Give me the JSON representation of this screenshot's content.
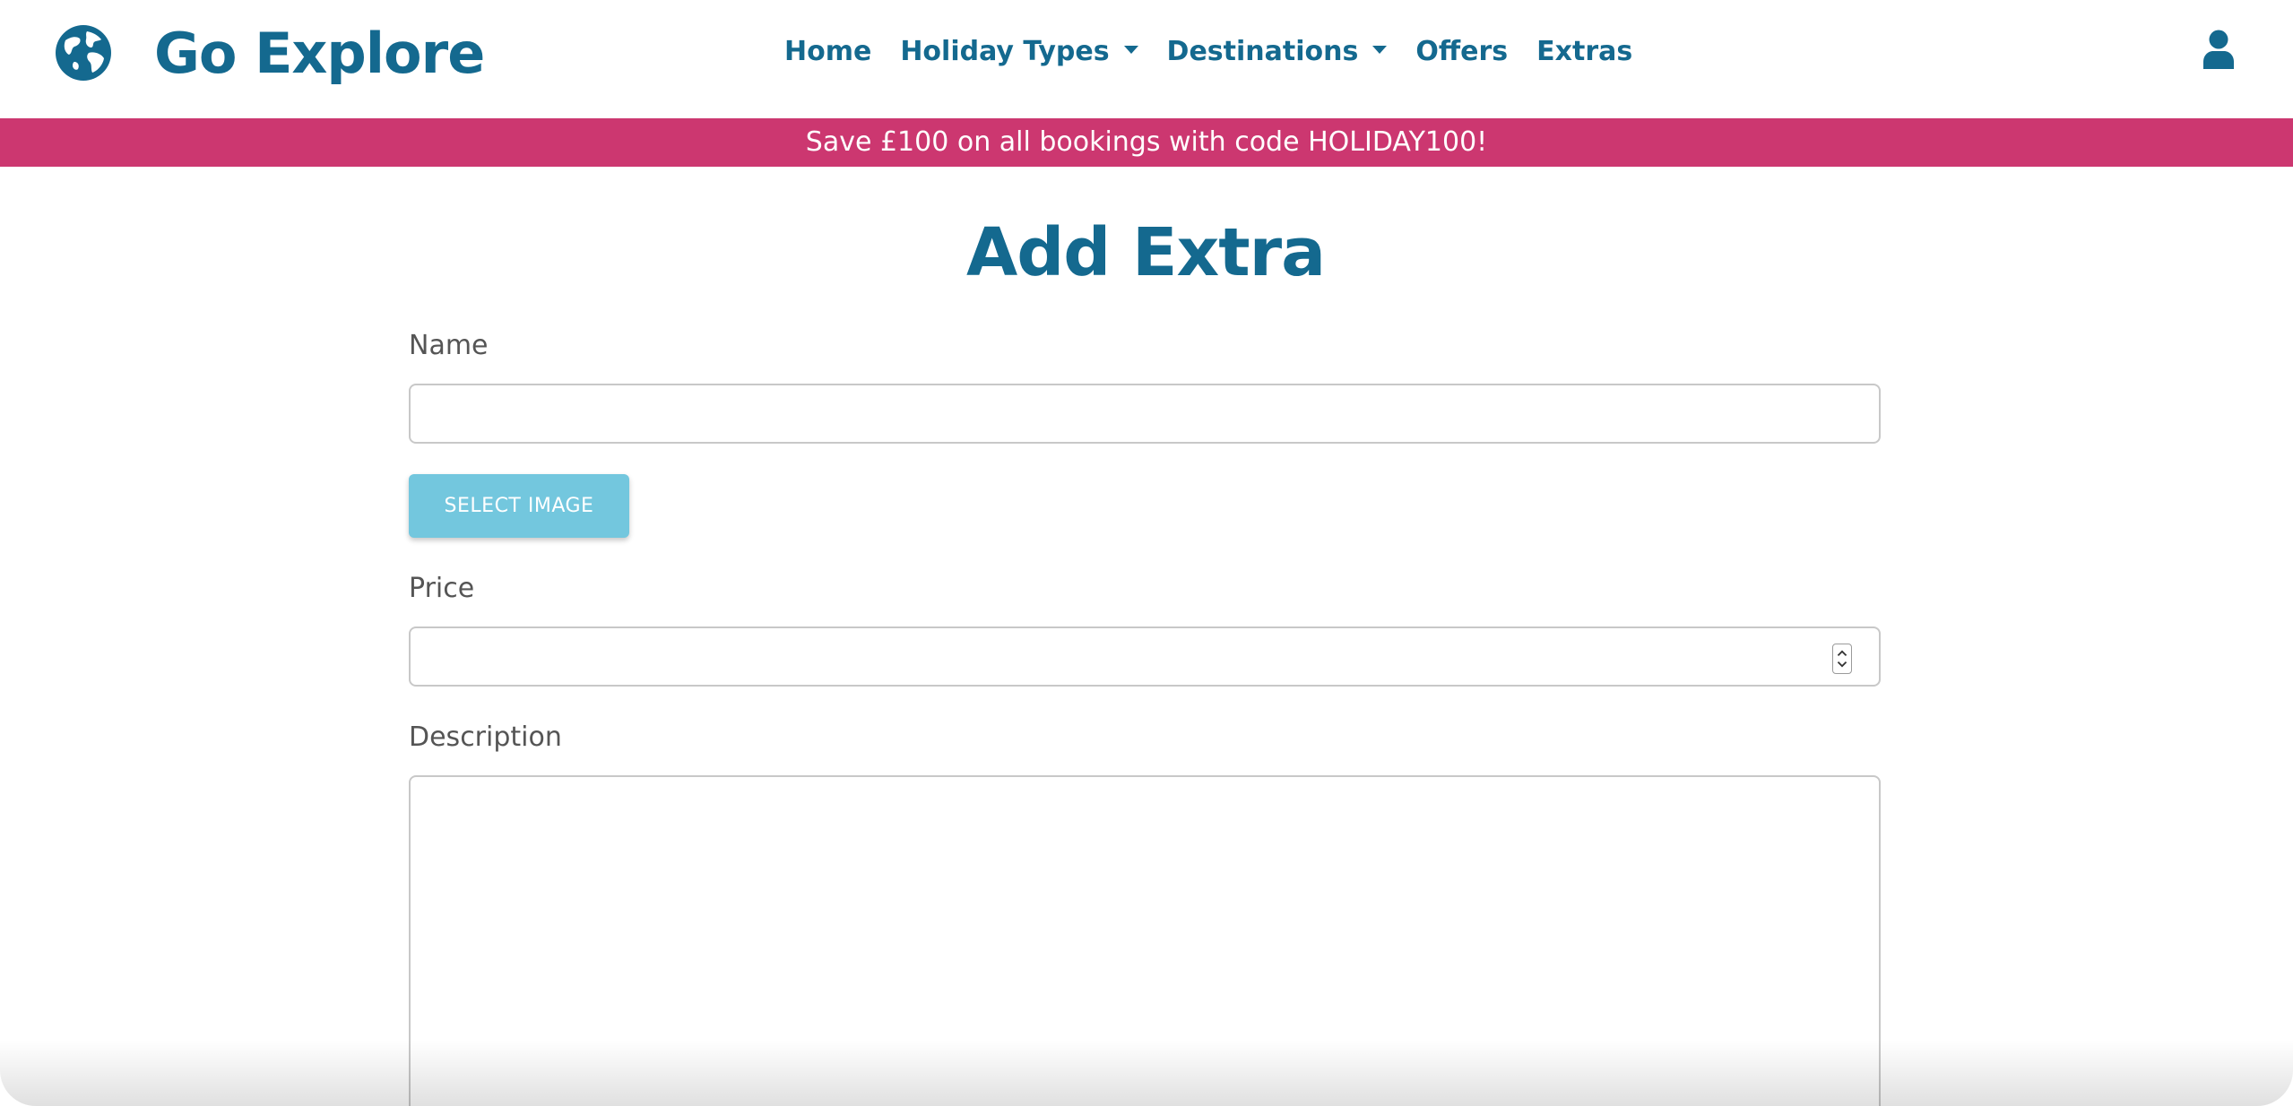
{
  "brand": {
    "name": "Go Explore",
    "icon": "globe-icon"
  },
  "nav": {
    "items": [
      {
        "label": "Home",
        "dropdown": false
      },
      {
        "label": "Holiday Types",
        "dropdown": true
      },
      {
        "label": "Destinations",
        "dropdown": true
      },
      {
        "label": "Offers",
        "dropdown": false
      },
      {
        "label": "Extras",
        "dropdown": false
      }
    ],
    "user_icon": "user-icon"
  },
  "promo": {
    "text": "Save £100 on all bookings with code HOLIDAY100!"
  },
  "form": {
    "title": "Add Extra",
    "name_label": "Name",
    "name_value": "",
    "select_image_label": "SELECT IMAGE",
    "price_label": "Price",
    "price_value": "",
    "description_label": "Description",
    "description_value": ""
  },
  "colors": {
    "brand": "#14698f",
    "promo_bg": "#cc3770",
    "button_bg": "#73c7de"
  }
}
